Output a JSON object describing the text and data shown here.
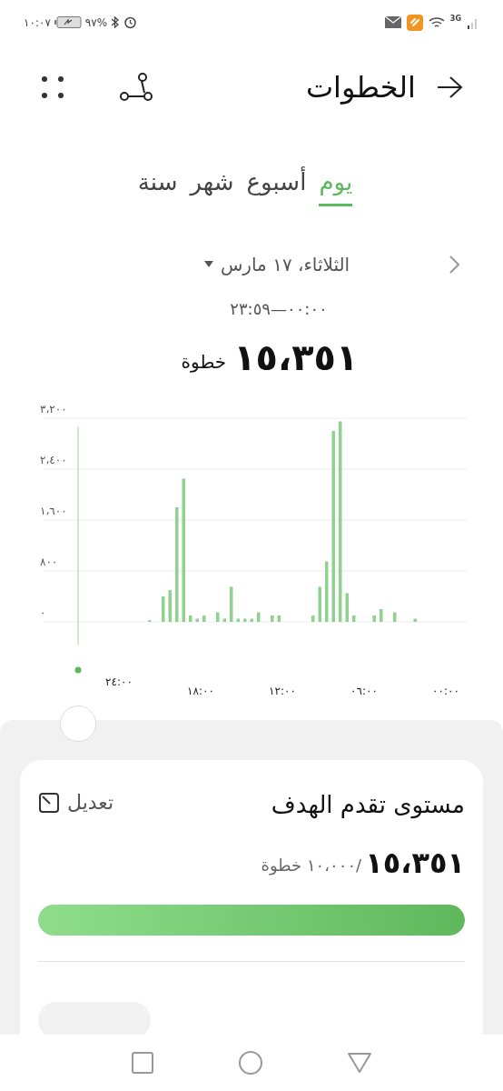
{
  "status_bar": {
    "network": "3G",
    "battery": "%٩٧",
    "time": "١٠:٠٧"
  },
  "header": {
    "title": "الخطوات"
  },
  "tabs": [
    {
      "label": "يوم",
      "selected": true
    },
    {
      "label": "أسبوع",
      "selected": false
    },
    {
      "label": "شهر",
      "selected": false
    },
    {
      "label": "سنة",
      "selected": false
    }
  ],
  "date": {
    "label": "الثلاثاء، ١٧ مارس",
    "range": "٠٠:٠٠—٢٣:٥٩"
  },
  "total": {
    "value": "١٥،٣٥١",
    "unit": "خطوة"
  },
  "chart": {
    "cursor_label": "٢٤:٠٠",
    "chart_data": {
      "type": "bar",
      "grid": true,
      "xlim": [
        29.5,
        -1.5
      ],
      "ylim": [
        0,
        3200
      ],
      "yticks": [
        {
          "value": 0,
          "label": "٠"
        },
        {
          "value": 800,
          "label": "٨٠٠"
        },
        {
          "value": 1600,
          "label": "١،٦٠٠"
        },
        {
          "value": 2400,
          "label": "٢،٤٠٠"
        },
        {
          "value": 3200,
          "label": "٣،٢٠٠"
        }
      ],
      "xticks": [
        {
          "value": 18,
          "label": "١٨:٠٠"
        },
        {
          "value": 12,
          "label": "١٢:٠٠"
        },
        {
          "value": 6,
          "label": "٠٦:٠٠"
        },
        {
          "value": 0,
          "label": "٠٠:٠٠"
        }
      ],
      "x": [
        21.75,
        20.75,
        20.25,
        19.75,
        19.25,
        18.75,
        18.25,
        17.75,
        16.75,
        16.25,
        15.75,
        15.25,
        14.75,
        14.25,
        13.75,
        12.75,
        12.25,
        9.75,
        9.25,
        8.75,
        8.25,
        7.75,
        7.25,
        6.75,
        5.25,
        4.75,
        3.75,
        2.25
      ],
      "series": [
        {
          "color": "#8fd18f",
          "values": [
            25,
            400,
            500,
            1800,
            2250,
            100,
            50,
            100,
            150,
            50,
            550,
            50,
            50,
            50,
            150,
            100,
            100,
            100,
            550,
            950,
            3000,
            3150,
            450,
            100,
            100,
            200,
            150,
            50
          ]
        }
      ]
    }
  },
  "goal_card": {
    "title": "مستوى تقدم الهدف",
    "edit": "تعديل",
    "value": "١٥،٣٥١",
    "target": "/١٠،٠٠٠ خطوة",
    "level": 1
  }
}
